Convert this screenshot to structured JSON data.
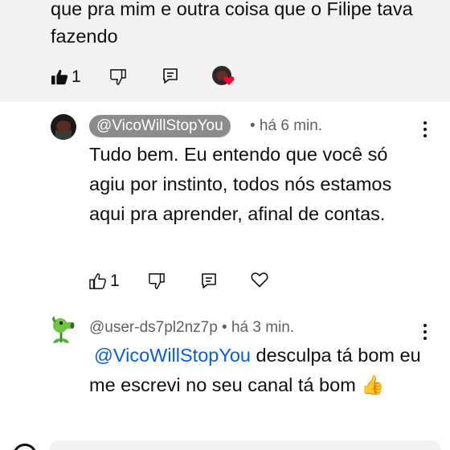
{
  "parent_comment": {
    "text_tail": "que pra mim e outra coisa que o Filipe tava fazendo",
    "like_count": "1"
  },
  "reply1": {
    "author": "@VicoWillStopYou",
    "time": "• há 6 min.",
    "text": "Tudo bem. Eu entendo que você só agiu por instinto, todos nós estamos aqui pra aprender, afinal de contas.",
    "like_count": "1"
  },
  "reply2": {
    "author": "@user-ds7pl2nz7p",
    "time": "• há 3 min.",
    "mention": "@VicoWillStopYou",
    "text": " desculpa tá bom eu me escrevi no seu canal tá bom 👍"
  },
  "icons": [
    "thumbs-up-icon",
    "thumbs-down-icon",
    "reply-icon",
    "heart-icon",
    "more-vert-icon"
  ],
  "colors": {
    "mention": "#065fd4",
    "chip": "#8c8c8c",
    "heart": "#ff0033",
    "meta": "#606060"
  }
}
